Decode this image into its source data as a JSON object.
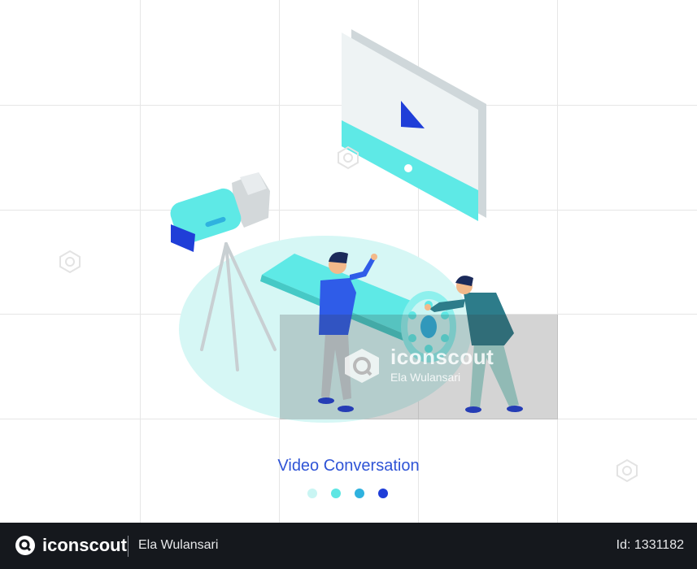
{
  "illustration": {
    "caption": "Video Conversation",
    "pagination_dots": [
      {
        "color": "#c9f5f3"
      },
      {
        "color": "#5ee6e3"
      },
      {
        "color": "#2fb2df"
      },
      {
        "color": "#1f3ed8"
      }
    ],
    "colors": {
      "accent": "#5ee9e6",
      "brand_blue": "#1f3ed8",
      "teal_dark": "#2d7c8a"
    }
  },
  "watermark": {
    "brand": "iconscout",
    "author": "Ela Wulansari"
  },
  "footer": {
    "brand": "iconscout",
    "author": "Ela Wulansari",
    "id_text": "Id: 1331182"
  }
}
